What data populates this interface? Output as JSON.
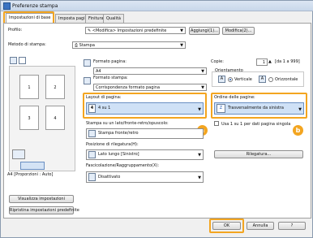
{
  "window": {
    "title": "Preferenze stampa"
  },
  "tabs": [
    "Impostazioni di base",
    "Imposta pagina",
    "Finitura",
    "Qualità"
  ],
  "profile": {
    "label": "Profilo:",
    "value": "<Modifica> Impostazioni predefinite",
    "add_label": "Aggiungi(1)...",
    "edit_label": "Modifica(2)..."
  },
  "method": {
    "label": "Metodo di stampa:",
    "value": "Stampa"
  },
  "page_format": {
    "label": "Formato pagina:",
    "value": "A4"
  },
  "output_format": {
    "label": "Formato stampa:",
    "value": "Corrispondenza formato pagina"
  },
  "copies": {
    "label": "Copie:",
    "value": "1",
    "range": "[da 1 a 999]"
  },
  "orientation": {
    "label": "Orientamento",
    "vertical": "Verticale",
    "horizontal": "Orizzontale",
    "selected": "Verticale"
  },
  "layout": {
    "label": "Layout di pagina:",
    "value": "4 su 1",
    "icon_number": "4"
  },
  "page_order": {
    "label": "Ordine delle pagine:",
    "value": "Trasversalmente da sinistra"
  },
  "duplex": {
    "label": "Stampa su un lato/fronte-retro/opuscolo:",
    "value": "Stampa fronte/retro",
    "use_one_label": "Usa 1 su 1 per dati pagina singola"
  },
  "binding": {
    "label": "Posizione di rilegatura(H):",
    "value": "Lato lungo [Sinistro]",
    "button": "Rilegatura..."
  },
  "collate": {
    "label": "Fascicolazione/Raggruppamento(X):",
    "value": "Disattivato"
  },
  "preview": {
    "caption": "A4 [Proporzioni : Auto]",
    "pages": [
      "1",
      "2",
      "3",
      "4"
    ]
  },
  "left_buttons": {
    "view": "Visualizza impostazioni",
    "restore": "Ripristina impostazioni predefinite"
  },
  "badges": {
    "a": "a",
    "b": "b"
  },
  "bottom_buttons": {
    "ok": "OK",
    "cancel": "Annulla",
    "help": "?"
  }
}
